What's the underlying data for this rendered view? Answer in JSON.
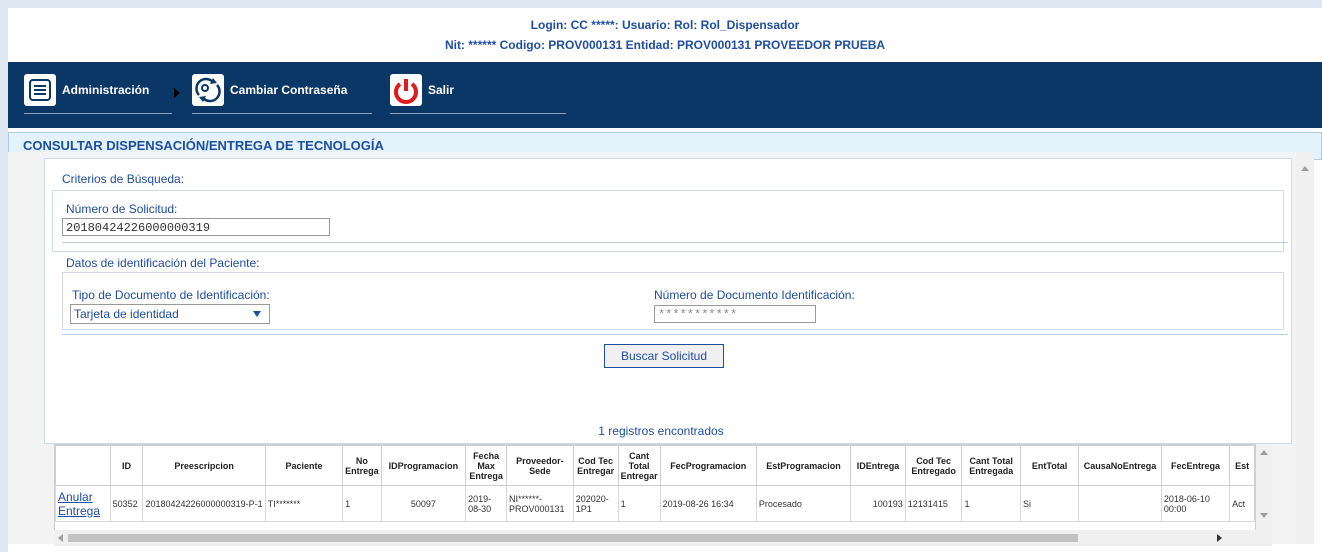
{
  "header": {
    "line1": "Login: CC *****: Usuario: Rol: Rol_Dispensador",
    "line2": "Nit: ****** Codigo: PROV000131 Entidad: PROV000131 PROVEEDOR PRUEBA"
  },
  "nav": {
    "admin_label": "Administración",
    "password_label": "Cambiar Contraseña",
    "exit_label": "Salir"
  },
  "page_title": "CONSULTAR DISPENSACIÓN/ENTREGA DE TECNOLOGÍA",
  "form": {
    "criteria_label": "Criterios de Búsqueda:",
    "request_label": "Número de Solicitud:",
    "request_value": "20180424226000000319",
    "patient_label": "Datos de identificación del Paciente:",
    "doc_type_label": "Tipo de Documento de Identificación:",
    "doc_type_value": "Tarjeta de identidad",
    "doc_number_label": "Número de Documento Identificación:",
    "doc_number_value": "***********",
    "search_button": "Buscar Solicitud"
  },
  "results": {
    "count_text": "1 registros encontrados",
    "headers": [
      "",
      "ID",
      "Preescripcion",
      "Paciente",
      "No Entrega",
      "IDProgramacion",
      "Fecha Max Entrega",
      "Proveedor-Sede",
      "Cod Tec Entregar",
      "Cant Total Entregar",
      "FecProgramacion",
      "EstProgramacion",
      "IDEntrega",
      "Cod Tec Entregado",
      "Cant Total Entregada",
      "EntTotal",
      "CausaNoEntrega",
      "FecEntrega",
      "Est"
    ],
    "row": {
      "action": "Anular Entrega",
      "cells": [
        "50352",
        "20180424226000000319-P-1",
        "TI*******",
        "1",
        "50097",
        "2019-08-30",
        "NI******-PROV000131",
        "202020-1P1",
        "1",
        "2019-08-26 16:34",
        "Procesado",
        "100193",
        "12131415",
        "1",
        "Si",
        "",
        "2018-06-10 00:00",
        "Act"
      ]
    }
  },
  "colors": {
    "nav_bg": "#0a3766",
    "accent": "#1f4ea1",
    "title_bg": "#e4f2fb",
    "exit_icon": "#e01b1b"
  },
  "icons": [
    "list-icon",
    "arrow-right-icon",
    "key-refresh-icon",
    "power-icon"
  ]
}
